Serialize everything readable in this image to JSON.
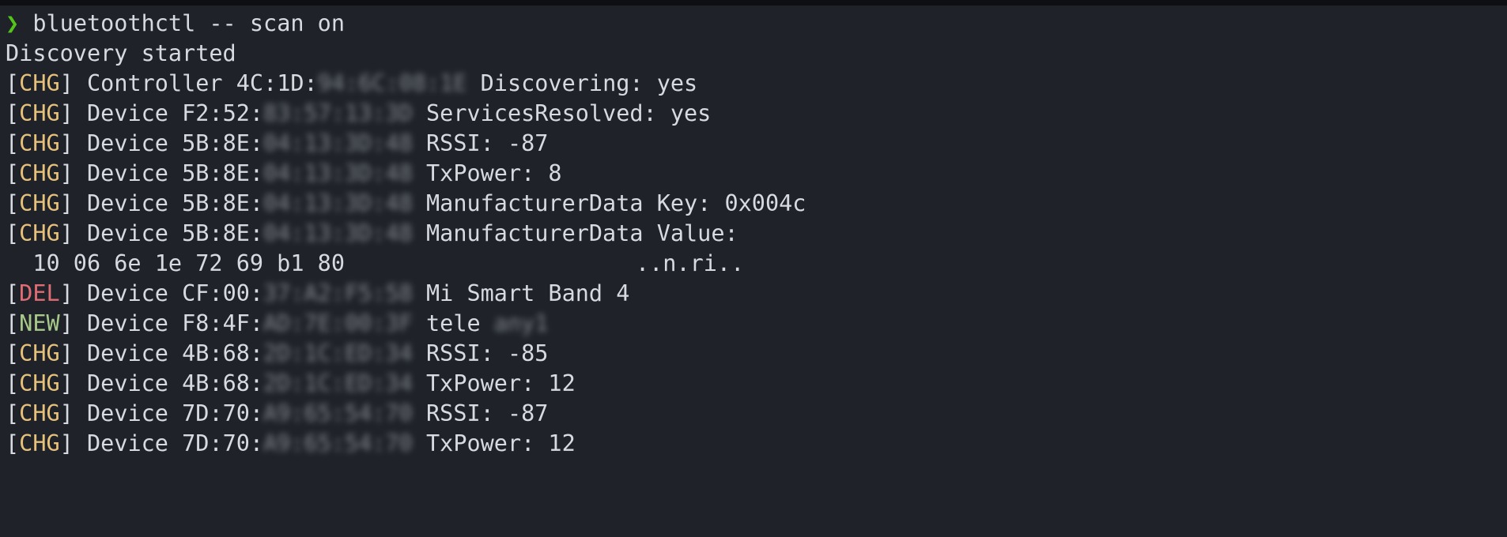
{
  "prompt": {
    "symbol": "❯",
    "command": "bluetoothctl -- scan on"
  },
  "status_line": "Discovery started",
  "controller_line": {
    "tag": "CHG",
    "kind": "Controller",
    "addr_visible": "4C:1D:",
    "addr_hidden": "94:6C:08:1E",
    "message": "Discovering: yes"
  },
  "device_lines": [
    {
      "tag": "CHG",
      "tag_class": "chg",
      "kind": "Device",
      "addr_visible": "F2:52:",
      "addr_hidden": "83:57:13:3D",
      "message": "ServicesResolved: yes"
    },
    {
      "tag": "CHG",
      "tag_class": "chg",
      "kind": "Device",
      "addr_visible": "5B:8E:",
      "addr_hidden": "04:13:3D:48",
      "message": "RSSI: -87"
    },
    {
      "tag": "CHG",
      "tag_class": "chg",
      "kind": "Device",
      "addr_visible": "5B:8E:",
      "addr_hidden": "04:13:3D:48",
      "message": "TxPower: 8"
    },
    {
      "tag": "CHG",
      "tag_class": "chg",
      "kind": "Device",
      "addr_visible": "5B:8E:",
      "addr_hidden": "04:13:3D:48",
      "message": "ManufacturerData Key: 0x004c"
    },
    {
      "tag": "CHG",
      "tag_class": "chg",
      "kind": "Device",
      "addr_visible": "5B:8E:",
      "addr_hidden": "04:13:3D:48",
      "message": "ManufacturerData Value:"
    }
  ],
  "hexdump": {
    "bytes": "10 06 6e 1e 72 69 b1 80",
    "ascii": "..n.ri.."
  },
  "device_lines_after": [
    {
      "tag": "DEL",
      "tag_class": "del",
      "kind": "Device",
      "addr_visible": "CF:00:",
      "addr_hidden": "37:A2:F5:58",
      "message": "Mi Smart Band 4",
      "message_hidden": ""
    },
    {
      "tag": "NEW",
      "tag_class": "new",
      "kind": "Device",
      "addr_visible": "F8:4F:",
      "addr_hidden": "AD:7E:00:3F",
      "message": "tele ",
      "message_hidden": "any1"
    },
    {
      "tag": "CHG",
      "tag_class": "chg",
      "kind": "Device",
      "addr_visible": "4B:68:",
      "addr_hidden": "2D:1C:ED:34",
      "message": "RSSI: -85",
      "message_hidden": ""
    },
    {
      "tag": "CHG",
      "tag_class": "chg",
      "kind": "Device",
      "addr_visible": "4B:68:",
      "addr_hidden": "2D:1C:ED:34",
      "message": "TxPower: 12",
      "message_hidden": ""
    },
    {
      "tag": "CHG",
      "tag_class": "chg",
      "kind": "Device",
      "addr_visible": "7D:70:",
      "addr_hidden": "A9:65:54:70",
      "message": "RSSI: -87",
      "message_hidden": ""
    },
    {
      "tag": "CHG",
      "tag_class": "chg",
      "kind": "Device",
      "addr_visible": "7D:70:",
      "addr_hidden": "A9:65:54:70",
      "message": "TxPower: 12",
      "message_hidden": ""
    }
  ],
  "colors": {
    "background": "#1f2329",
    "prompt": "#52c41a",
    "chg": "#e7c17a",
    "del": "#e06c75",
    "new": "#a8c98a",
    "text": "#d7dae0"
  }
}
